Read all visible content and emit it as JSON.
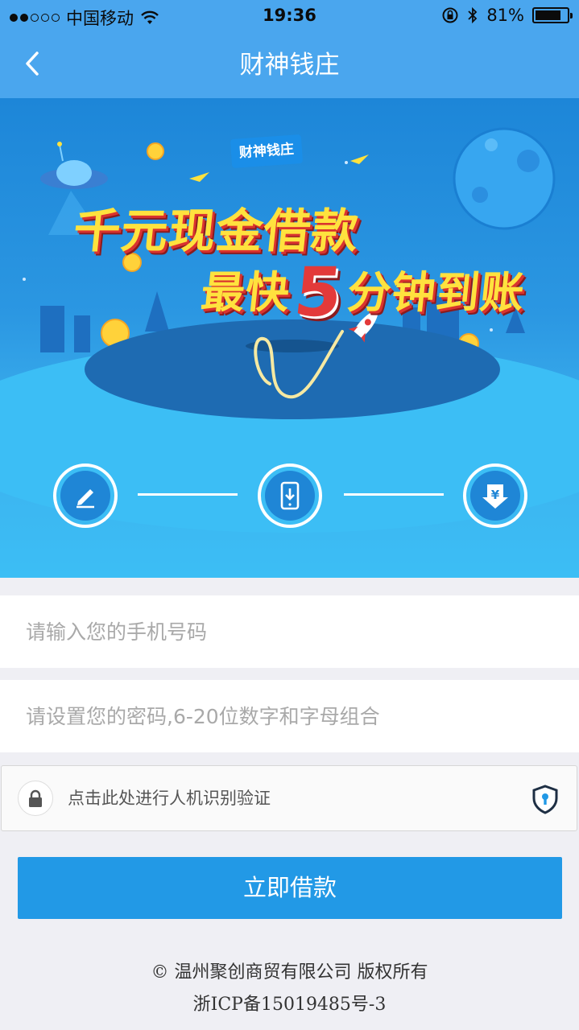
{
  "status_bar": {
    "carrier": "中国移动",
    "time": "19:36",
    "battery": "81%",
    "battery_level": 0.81,
    "signal_bars": 2,
    "signal_total": 5
  },
  "nav": {
    "back_icon": "chevron-left-icon",
    "title": "财神钱庄"
  },
  "banner": {
    "badge": "财神钱庄",
    "headline_line1": "千元现金借款",
    "headline_line2_prefix": "最快",
    "headline_line2_number": "5",
    "headline_line2_suffix": "分钟到账",
    "steps": [
      {
        "icon": "pencil-icon"
      },
      {
        "icon": "phone-download-icon"
      },
      {
        "icon": "yuan-download-icon"
      }
    ]
  },
  "form": {
    "phone_placeholder": "请输入您的手机号码",
    "phone_value": "",
    "password_placeholder": "请设置您的密码,6-20位数字和字母组合",
    "password_value": "",
    "captcha_label": "点击此处进行人机识别验证",
    "submit_label": "立即借款"
  },
  "footer": {
    "copyright": "© 温州聚创商贸有限公司 版权所有",
    "icp": "浙ICP备15019485号-3"
  },
  "colors": {
    "header": "#4aa6ee",
    "button": "#2299e6",
    "headline_yellow": "#ffe23e",
    "headline_red": "#e33a3a"
  }
}
